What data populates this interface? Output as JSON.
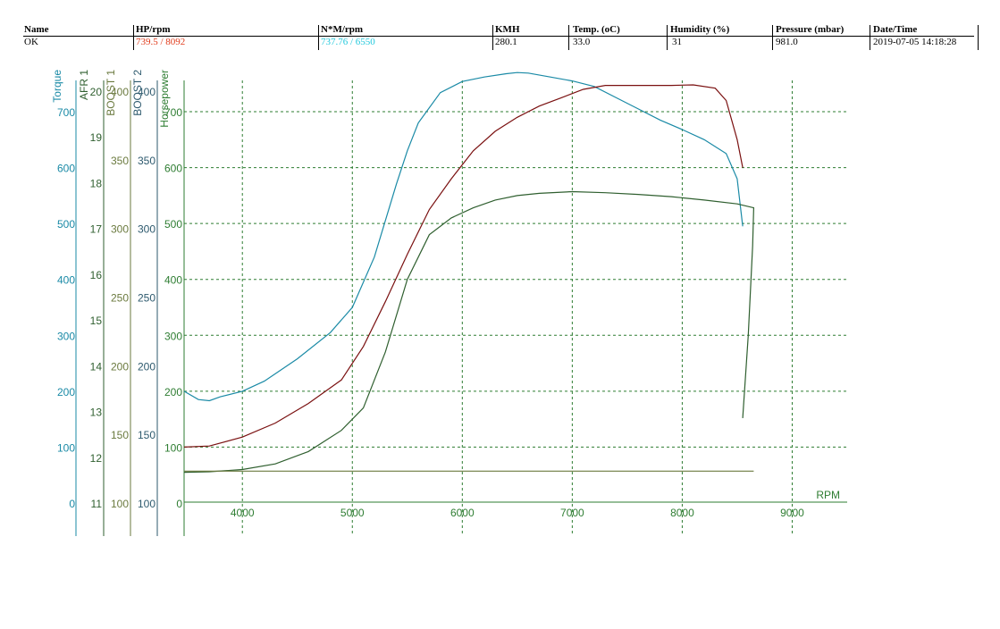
{
  "header": {
    "columns": [
      "Name",
      "HP/rpm",
      "N*M/rpm",
      "KMH",
      "Temp. (oC)",
      "Humidity (%)",
      "Pressure (mbar)",
      "Date/Time"
    ],
    "values": {
      "name": "OK",
      "hp_rpm": "739.5 / 8092",
      "nm_rpm": "737.76 / 6550",
      "kmh": "280.1",
      "temp": "33.0",
      "humidity": "31",
      "pressure": "981.0",
      "datetime": "2019-07-05 14:18:28"
    }
  },
  "colors": {
    "torque": "#1a8aa6",
    "hp": "#7a1010",
    "afr": "#2f5f2f",
    "boost": "#6b7a3f",
    "boost2": "#2e5a6e",
    "grid": "#2e7d32",
    "hp_value_text": "#e03a1a",
    "nm_value_text": "#22c8dc"
  },
  "chart_data": {
    "type": "line",
    "xlabel": "RPM",
    "xlim": [
      3470,
      9500
    ],
    "x_ticks": [
      4000,
      5000,
      6000,
      7000,
      8000,
      9000
    ],
    "axes": [
      {
        "name": "Torque",
        "ticks": [
          0,
          100,
          200,
          300,
          400,
          500,
          600,
          700
        ],
        "range": [
          0,
          700
        ]
      },
      {
        "name": "AFR 1",
        "ticks": [
          11,
          12,
          13,
          14,
          15,
          16,
          17,
          18,
          19,
          20
        ],
        "range": [
          11,
          20
        ]
      },
      {
        "name": "BOOST 1",
        "ticks": [
          100,
          150,
          200,
          250,
          300,
          350,
          400
        ],
        "range": [
          100,
          400
        ]
      },
      {
        "name": "BOOST 2",
        "ticks": [
          100,
          150,
          200,
          250,
          300,
          350,
          400
        ],
        "range": [
          100,
          400
        ]
      },
      {
        "name": "Horsepower",
        "ticks": [
          0,
          100,
          200,
          300,
          400,
          500,
          600,
          700
        ],
        "range": [
          0,
          700
        ]
      }
    ],
    "series": [
      {
        "name": "Torque",
        "axis": "Horsepower",
        "color_key": "torque",
        "x": [
          3470,
          3600,
          3700,
          3800,
          4000,
          4200,
          4500,
          4800,
          5000,
          5200,
          5400,
          5500,
          5600,
          5800,
          6000,
          6200,
          6400,
          6500,
          6600,
          6800,
          7000,
          7200,
          7400,
          7600,
          7800,
          8000,
          8200,
          8400,
          8500,
          8550
        ],
        "y": [
          200,
          185,
          183,
          190,
          200,
          218,
          258,
          305,
          350,
          440,
          570,
          630,
          680,
          734,
          754,
          762,
          768,
          770,
          769,
          762,
          755,
          745,
          725,
          705,
          685,
          668,
          650,
          625,
          580,
          495
        ]
      },
      {
        "name": "Horsepower",
        "axis": "Horsepower",
        "color_key": "hp",
        "x": [
          3470,
          3700,
          4000,
          4300,
          4600,
          4900,
          5100,
          5300,
          5500,
          5700,
          5900,
          6100,
          6300,
          6500,
          6700,
          6900,
          7100,
          7300,
          7500,
          7700,
          7900,
          8100,
          8300,
          8400,
          8500,
          8550
        ],
        "y": [
          100,
          102,
          118,
          143,
          178,
          220,
          280,
          360,
          445,
          525,
          580,
          630,
          665,
          690,
          710,
          725,
          740,
          747,
          747,
          747,
          747,
          748,
          742,
          720,
          650,
          600
        ]
      },
      {
        "name": "AFR 1",
        "axis": "Horsepower",
        "color_key": "afr",
        "x": [
          3470,
          3700,
          4000,
          4300,
          4600,
          4900,
          5100,
          5300,
          5500,
          5700,
          5900,
          6100,
          6300,
          6500,
          6700,
          7000,
          7300,
          7600,
          7900,
          8200,
          8500,
          8650,
          8640,
          8600,
          8550
        ],
        "y": [
          55,
          56,
          60,
          70,
          92,
          130,
          170,
          270,
          400,
          480,
          510,
          528,
          542,
          550,
          554,
          557,
          555,
          552,
          548,
          542,
          535,
          528,
          460,
          300,
          152
        ]
      },
      {
        "name": "BOOST 1",
        "axis": "Horsepower",
        "color_key": "boost",
        "x": [
          3470,
          4000,
          4500,
          5000,
          5500,
          6000,
          6500,
          7000,
          7500,
          8000,
          8500,
          8650
        ],
        "y": [
          57,
          57,
          57,
          57,
          57,
          57,
          57,
          57,
          57,
          57,
          57,
          57
        ]
      }
    ]
  }
}
